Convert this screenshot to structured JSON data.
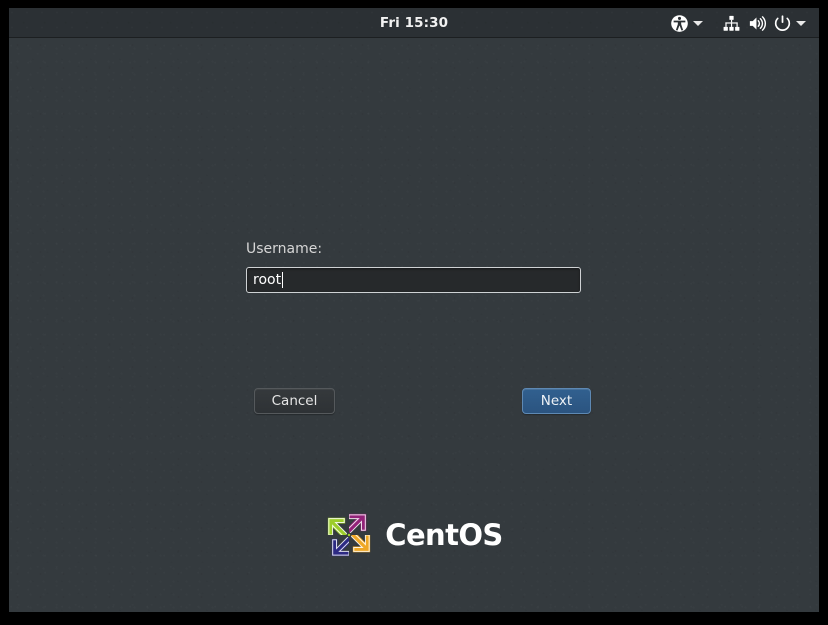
{
  "topbar": {
    "clock": "Fri 15:30",
    "tray": [
      {
        "name": "accessibility-icon",
        "label": "Universal Access"
      },
      {
        "name": "chevron-down-icon",
        "label": "Accessibility menu"
      },
      {
        "name": "network-icon",
        "label": "Network"
      },
      {
        "name": "volume-icon",
        "label": "Volume"
      },
      {
        "name": "power-icon",
        "label": "Power"
      },
      {
        "name": "chevron-down-icon",
        "label": "System menu"
      }
    ]
  },
  "login": {
    "username_label": "Username:",
    "username_value": "root",
    "username_placeholder": "",
    "cancel_label": "Cancel",
    "next_label": "Next"
  },
  "brand": {
    "name": "CentOS",
    "logo_colors": {
      "top_left": "#9ccd2a",
      "top_right": "#932279",
      "bottom_left": "#262577",
      "bottom_right": "#efa724"
    }
  },
  "colors": {
    "bezel": "#000000",
    "background": "#343a3e",
    "topbar": "#2b3034",
    "accent": "#31608f",
    "text": "#ffffff"
  }
}
